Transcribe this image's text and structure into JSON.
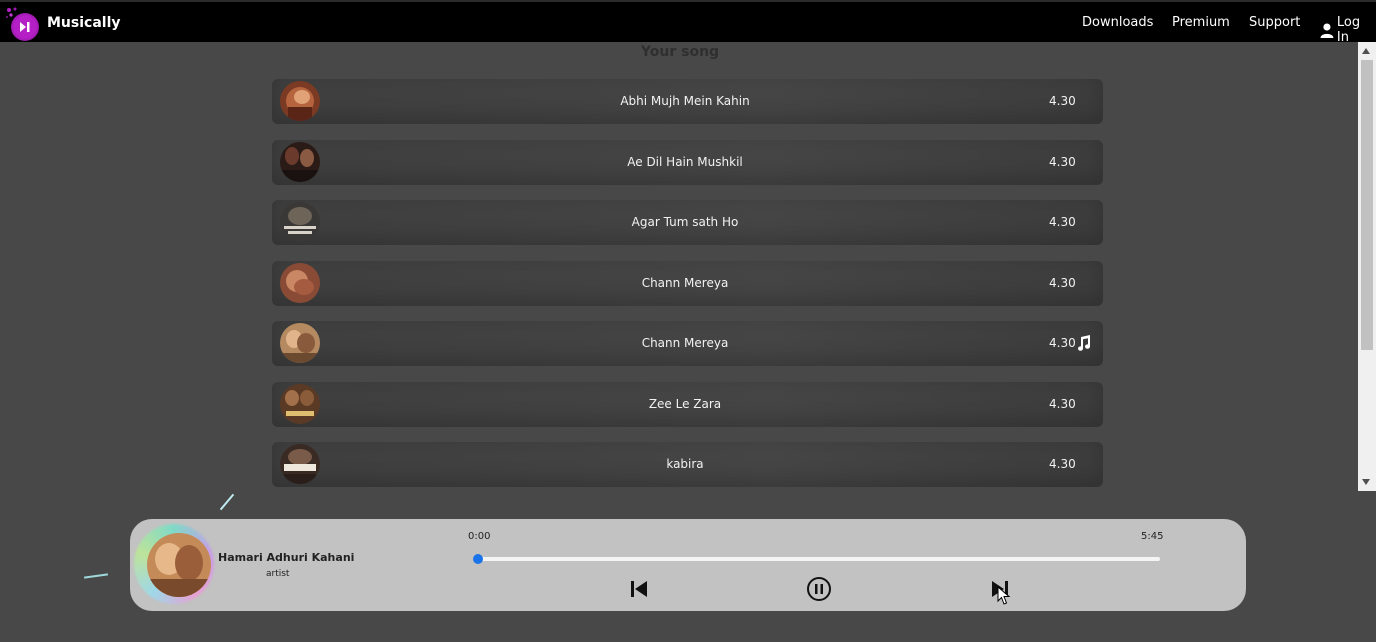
{
  "app": {
    "brand": "Musically"
  },
  "nav": {
    "downloads": "Downloads",
    "premium": "Premium",
    "support": "Support",
    "login": "Log In"
  },
  "list": {
    "title": "Your song",
    "songs": [
      {
        "name": "Abhi Mujh Mein Kahin",
        "duration": "4.30"
      },
      {
        "name": "Ae Dil Hain Mushkil",
        "duration": "4.30"
      },
      {
        "name": "Agar Tum sath Ho",
        "duration": "4.30"
      },
      {
        "name": "Chann Mereya",
        "duration": "4.30"
      },
      {
        "name": "Chann Mereya",
        "duration": "4.30",
        "playing": true
      },
      {
        "name": "Zee Le Zara",
        "duration": "4.30"
      },
      {
        "name": "kabira",
        "duration": "4.30"
      }
    ]
  },
  "player": {
    "title": "Hamari Adhuri Kahani",
    "artist": "artist",
    "current_time": "0:00",
    "total_time": "5:45",
    "progress": 0
  },
  "colors": {
    "background": "#484848",
    "topbar": "#000000",
    "player_bg": "#c2c2c2",
    "progress": "#1a73e8",
    "logo": "#b41fc6"
  },
  "icons": {
    "logo": "play-next-icon",
    "login": "user-icon",
    "playing": "music-note-icon",
    "prev": "skip-back-icon",
    "pause": "pause-icon",
    "next": "skip-forward-icon"
  }
}
